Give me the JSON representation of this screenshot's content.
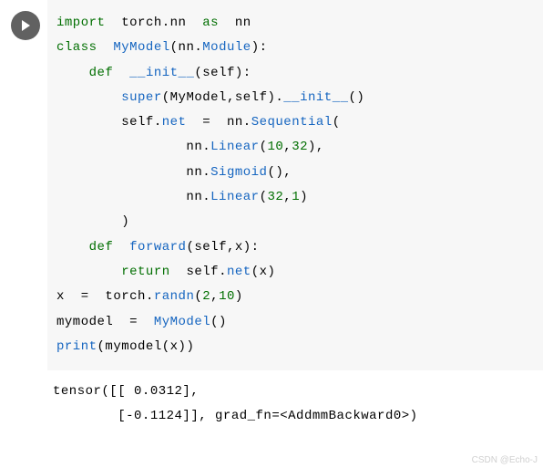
{
  "code": {
    "kw_import": "import",
    "mod_torch": "torch",
    "mod_nn1": "nn",
    "kw_as": "as",
    "mod_nn2": "nn",
    "kw_class": "class",
    "cls_mymodel": "MyModel",
    "cls_module": "Module",
    "kw_def1": "def",
    "fn_init": "__init__",
    "arg_self1": "self",
    "fn_super": "super",
    "fn_initcall": "__init__",
    "attr_self": "self",
    "attr_net": "net",
    "cls_sequential": "Sequential",
    "cls_linear1": "Linear",
    "num_10a": "10",
    "num_32a": "32",
    "cls_sigmoid": "Sigmoid",
    "cls_linear2": "Linear",
    "num_32b": "32",
    "num_1": "1",
    "kw_def2": "def",
    "fn_forward": "forward",
    "arg_self2": "self",
    "arg_x": "x",
    "kw_return": "return",
    "attr_self2": "self",
    "attr_net2": "net",
    "var_x2": "x",
    "var_x": "x",
    "mod_torch2": "torch",
    "fn_randn": "randn",
    "num_2": "2",
    "num_10b": "10",
    "var_mymodel": "mymodel",
    "cls_mymodel2": "MyModel",
    "fn_print": "print",
    "var_mymodel2": "mymodel",
    "var_x3": "x"
  },
  "output": {
    "line1": "tensor([[ 0.0312],",
    "line2": "        [-0.1124]], grad_fn=<AddmmBackward0>)"
  },
  "watermark": "CSDN @Echo-J"
}
